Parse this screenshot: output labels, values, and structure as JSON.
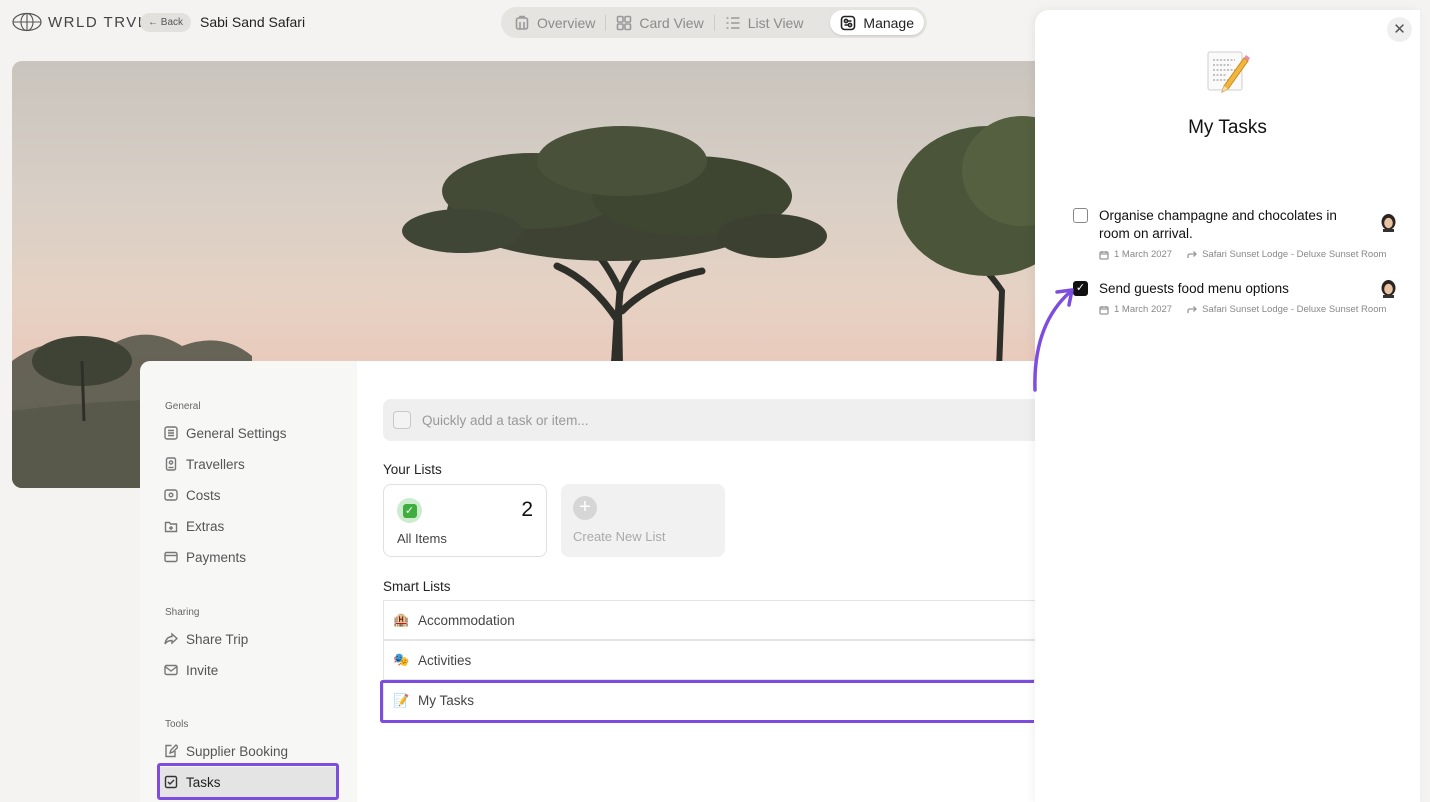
{
  "app": {
    "brand": "WRLD TRVL",
    "back_label": "← Back",
    "trip_title": "Sabi Sand Safari"
  },
  "view_tabs": [
    {
      "label": "Overview",
      "icon": "building-icon"
    },
    {
      "label": "Card View",
      "icon": "grid-icon"
    },
    {
      "label": "List View",
      "icon": "list-icon"
    },
    {
      "label": "Manage",
      "icon": "manage-icon",
      "active": true
    }
  ],
  "sidebar": {
    "general_heading": "General",
    "general_items": [
      "General Settings",
      "Travellers",
      "Costs",
      "Extras",
      "Payments"
    ],
    "sharing_heading": "Sharing",
    "sharing_items": [
      "Share Trip",
      "Invite"
    ],
    "tools_heading": "Tools",
    "tools_items": [
      "Supplier Booking",
      "Tasks"
    ],
    "active_item": "Tasks"
  },
  "main": {
    "quick_add_placeholder": "Quickly add a task or item...",
    "your_lists_title": "Your Lists",
    "all_items": {
      "label": "All Items",
      "count": "2"
    },
    "create_list_label": "Create New List",
    "smart_lists_title": "Smart Lists",
    "smart_lists": [
      {
        "label": "Accommodation",
        "emoji": "🏨"
      },
      {
        "label": "Activities",
        "emoji": "🎭"
      },
      {
        "label": "My Tasks",
        "emoji": "📝"
      }
    ]
  },
  "panel": {
    "close": "✕",
    "title": "My Tasks",
    "tasks": [
      {
        "text": "Organise champagne and chocolates in room on arrival.",
        "date": "1 March 2027",
        "location": "Safari Sunset Lodge - Deluxe Sunset Room",
        "checked": false
      },
      {
        "text": "Send guests food menu options",
        "date": "1 March 2027",
        "location": "Safari Sunset Lodge - Deluxe Sunset Room",
        "checked": true
      }
    ]
  },
  "colors": {
    "highlight": "#7c4ddf",
    "checkbox_checked": "#111111"
  }
}
